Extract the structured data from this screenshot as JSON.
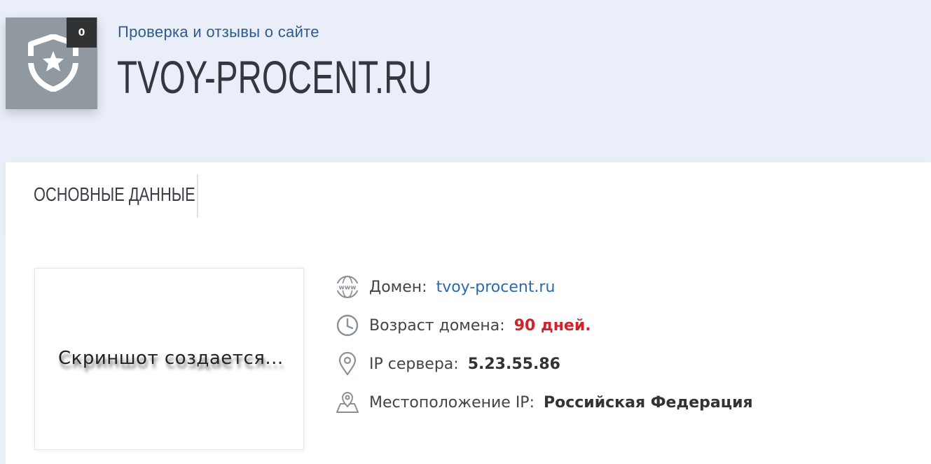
{
  "header": {
    "badge_count": "0",
    "subtitle": "Проверка и отзывы о сайте",
    "site_title": "TVOY-PROCENT.RU"
  },
  "tabs": [
    {
      "label": "ОСНОВНЫЕ ДАННЫЕ"
    }
  ],
  "screenshot": {
    "placeholder_text": "Скриншот создается..."
  },
  "info": {
    "domain": {
      "label": "Домен:",
      "value": "tvoy-procent.ru",
      "icon": "www-globe-icon"
    },
    "age": {
      "label": "Возраст домена:",
      "value": "90 дней.",
      "icon": "clock-icon"
    },
    "ip": {
      "label": "IP сервера:",
      "value": "5.23.55.86",
      "icon": "location-pin-icon"
    },
    "location": {
      "label": "Местоположение IP:",
      "value": "Российская Федерация",
      "icon": "map-icon"
    }
  },
  "colors": {
    "background": "#eaeef8",
    "badge_bg": "#8f999f",
    "link": "#2d6aa8",
    "age_value": "#d2232a",
    "subtitle": "#2d5b8e"
  }
}
